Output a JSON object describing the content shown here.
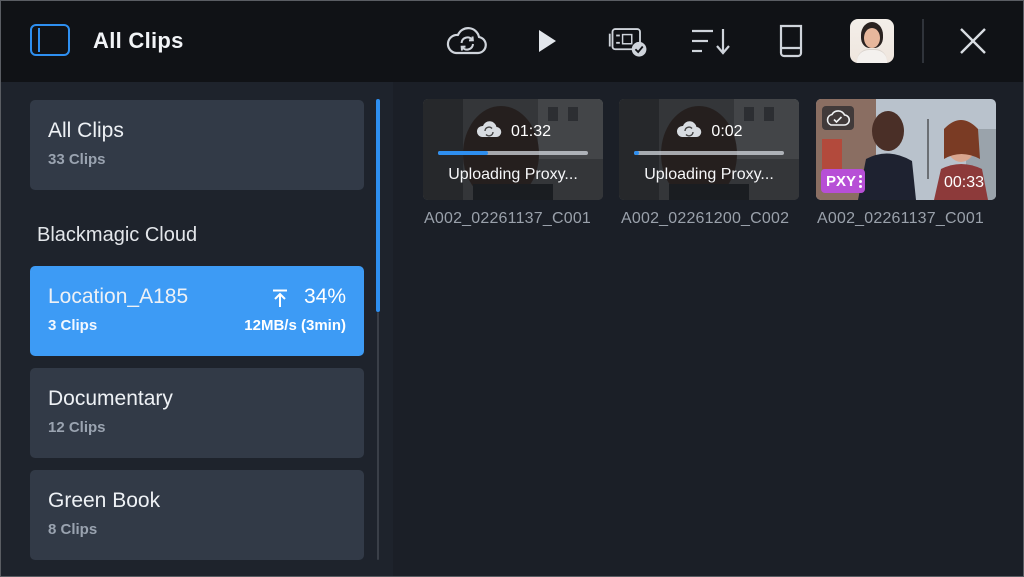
{
  "header": {
    "title": "All Clips",
    "icons": [
      "sidebar-toggle-icon",
      "cloud-sync-icon",
      "play-icon",
      "clips-check-icon",
      "sort-icon",
      "storage-drive-icon",
      "avatar",
      "close-icon"
    ]
  },
  "sidebar": {
    "all_clips": {
      "name": "All Clips",
      "count": "33 Clips"
    },
    "section_label": "Blackmagic Cloud",
    "items": [
      {
        "name": "Location_A185",
        "count": "3 Clips",
        "percent": "34%",
        "speed": "12MB/s (3min)",
        "active": true
      },
      {
        "name": "Documentary",
        "count": "12 Clips",
        "active": false
      },
      {
        "name": "Green Book",
        "count": "8 Clips",
        "active": false
      }
    ]
  },
  "clips": [
    {
      "name": "A002_02261137_C001",
      "time": "01:32",
      "status": "Uploading Proxy...",
      "progress": 0.33
    },
    {
      "name": "A002_02261200_C002",
      "time": "0:02",
      "status": "Uploading Proxy...",
      "progress": 0.03
    },
    {
      "name": "A002_02261137_C001",
      "badge": "PXY",
      "duration": "00:33"
    }
  ],
  "colors": {
    "accent": "#2e8ff0",
    "active_card": "#3d9bf5",
    "card": "#323a47",
    "proxy_badge": "#b74fd6"
  }
}
